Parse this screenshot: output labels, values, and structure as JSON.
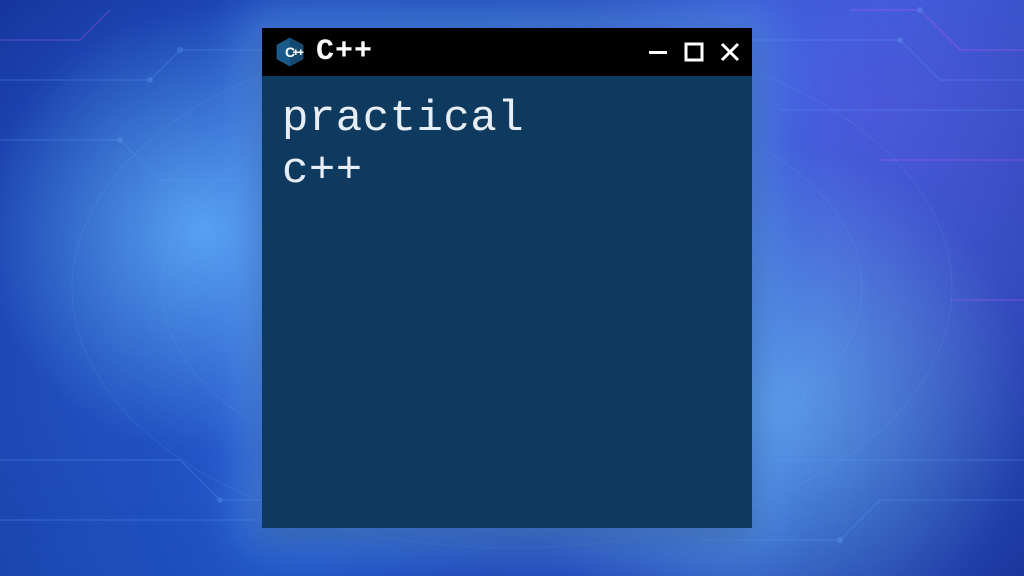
{
  "window": {
    "title": "C++",
    "icon_name": "cpp-logo",
    "content_lines": [
      "practical",
      "c++"
    ]
  },
  "colors": {
    "titlebar_bg": "#000000",
    "content_bg": "#0f3a5f",
    "text": "#e8eef5",
    "logo_fill": "#1a5a8a",
    "logo_text": "#ffffff"
  }
}
